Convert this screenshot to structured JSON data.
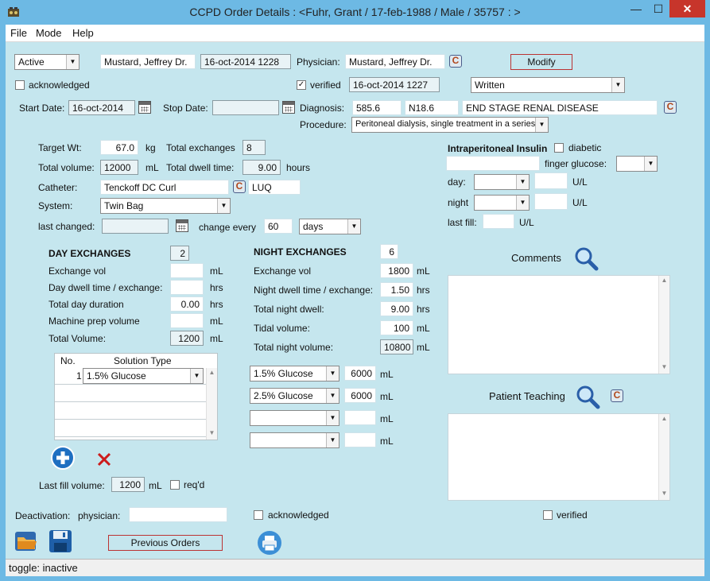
{
  "window": {
    "title": "CCPD Order Details :   <Fuhr, Grant  / 17-feb-1988 / Male / 35757 : >",
    "min": "—",
    "max": "☐",
    "close": "✕"
  },
  "menu": [
    "File",
    "Mode",
    "Help"
  ],
  "header": {
    "status_value": "Active",
    "ordered_by": "Mustard, Jeffrey Dr.",
    "ordered_date": "16-oct-2014 1228",
    "physician_label": "Physician:",
    "physician_value": "Mustard, Jeffrey Dr.",
    "modify_label": "Modify",
    "acknowledged_label": "acknowledged",
    "verified_label": "verified",
    "verified_checked": "✓",
    "verified_date": "16-oct-2014 1227",
    "order_type_value": "Written",
    "start_date_label": "Start Date:",
    "start_date_value": "16-oct-2014",
    "stop_date_label": "Stop Date:",
    "stop_date_value": "",
    "diagnosis_label": "Diagnosis:",
    "diagnosis_code1": "585.6",
    "diagnosis_code2": "N18.6",
    "diagnosis_text": "END STAGE RENAL DISEASE",
    "procedure_label": "Procedure:",
    "procedure_value": "Peritoneal dialysis, single treatment in a series"
  },
  "prescription": {
    "target_wt_label": "Target Wt:",
    "target_wt_value": "67.0",
    "target_wt_unit": "kg",
    "total_exchanges_label": "Total exchanges",
    "total_exchanges_value": "8",
    "total_volume_label": "Total volume:",
    "total_volume_value": "12000",
    "total_volume_unit": "mL",
    "total_dwell_label": "Total dwell time:",
    "total_dwell_value": "9.00",
    "total_dwell_unit": "hours",
    "catheter_label": "Catheter:",
    "catheter_value": "Tenckoff DC Curl",
    "catheter_site": "LUQ",
    "system_label": "System:",
    "system_value": "Twin Bag",
    "last_changed_label": "last changed:",
    "last_changed_value": "",
    "change_every_label": "change every",
    "change_every_value": "60",
    "change_every_unit": "days"
  },
  "insulin": {
    "title": "Intraperitoneal Insulin",
    "diabetic_label": "diabetic",
    "finger_glucose_label": "finger glucose:",
    "day_label": "day:",
    "night_label": "night",
    "last_fill_label": "last fill:",
    "unit": "U/L"
  },
  "day_exchanges": {
    "title": "DAY EXCHANGES",
    "count": "2",
    "exchange_vol_label": "Exchange vol",
    "dwell_label": "Day dwell time / exchange:",
    "duration_label": "Total day duration",
    "duration_value": "0.00",
    "prep_label": "Machine prep volume",
    "total_volume_label": "Total Volume:",
    "total_volume_value": "1200",
    "ml": "mL",
    "hrs": "hrs"
  },
  "solution_grid": {
    "col_no": "No.",
    "col_type": "Solution Type",
    "rows": [
      {
        "no": "1",
        "type": "1.5% Glucose"
      }
    ]
  },
  "night_exchanges": {
    "title": "NIGHT EXCHANGES",
    "count": "6",
    "exchange_vol_label": "Exchange vol",
    "exchange_vol_value": "1800",
    "dwell_label": "Night dwell time / exchange:",
    "dwell_value": "1.50",
    "total_dwell_label": "Total night dwell:",
    "total_dwell_value": "9.00",
    "tidal_label": "Tidal volume:",
    "tidal_value": "100",
    "total_volume_label": "Total night volume:",
    "total_volume_value": "10800",
    "ml": "mL",
    "hrs": "hrs",
    "solutions": [
      {
        "type": "1.5% Glucose",
        "volume": "6000"
      },
      {
        "type": "2.5% Glucose",
        "volume": "6000"
      },
      {
        "type": "",
        "volume": ""
      },
      {
        "type": "",
        "volume": ""
      }
    ]
  },
  "last_fill": {
    "label": "Last fill volume:",
    "value": "1200",
    "unit": "mL",
    "reqd_label": "req'd"
  },
  "comments": {
    "label": "Comments"
  },
  "teaching": {
    "label": "Patient Teaching"
  },
  "deactivation": {
    "label": "Deactivation:",
    "physician_label": "physician:",
    "acknowledged_label": "acknowledged",
    "verified_label": "verified"
  },
  "footer": {
    "previous_orders_label": "Previous Orders",
    "status_text": "toggle: inactive"
  },
  "colors": {
    "panel": "#c5e6ee",
    "titlebar": "#6db9e4",
    "accent_outline": "#b33333"
  }
}
